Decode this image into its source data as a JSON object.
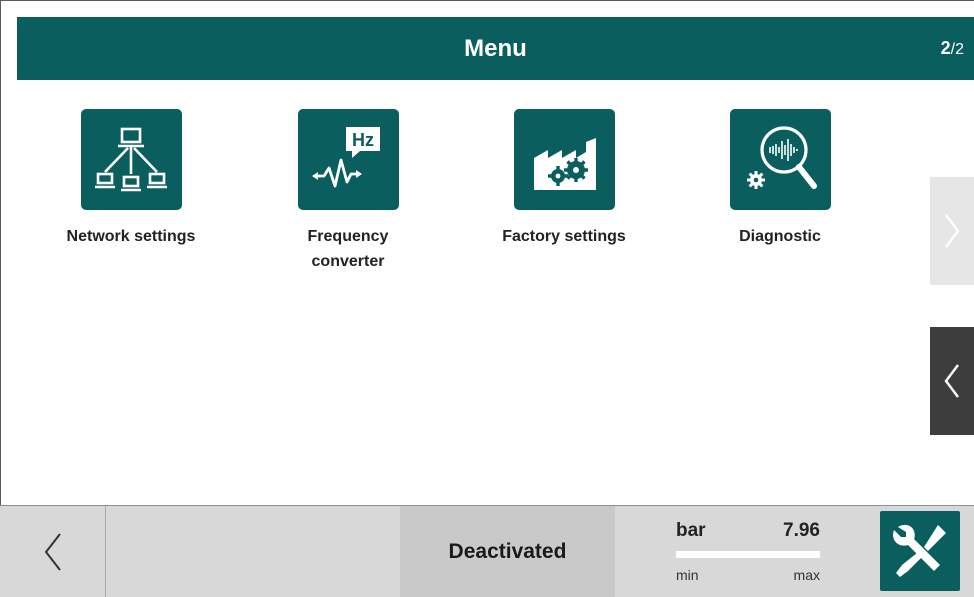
{
  "header": {
    "title": "Menu",
    "page_current": "2",
    "page_total": "/2"
  },
  "tiles": [
    {
      "label": "Network settings",
      "icon": "network-icon"
    },
    {
      "label": "Frequency\nconverter",
      "icon": "frequency-converter-icon",
      "icon_text": "Hz"
    },
    {
      "label": "Factory settings",
      "icon": "factory-icon"
    },
    {
      "label": "Diagnostic",
      "icon": "diagnostic-icon"
    }
  ],
  "side_nav": {
    "next_icon": "chevron-right-icon",
    "prev_icon": "chevron-left-icon"
  },
  "footer": {
    "back_icon": "chevron-left-icon",
    "status": "Deactivated",
    "gauge": {
      "unit": "bar",
      "value": "7.96",
      "min_label": "min",
      "max_label": "max",
      "level_fraction": 0
    },
    "tools_icon": "wrench-screwdriver-icon"
  },
  "colors": {
    "accent": "#0b5e5e",
    "footer_bg": "#d8d8d8",
    "status_bg": "#c9c9c9",
    "side_next_bg": "#e6e6e6",
    "side_prev_bg": "#3d3d3d"
  }
}
